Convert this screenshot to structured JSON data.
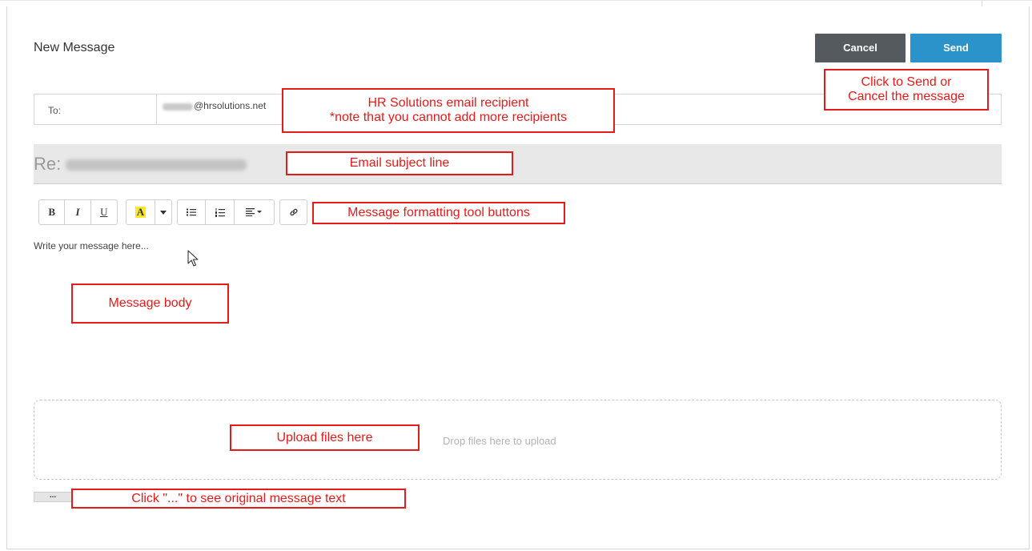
{
  "compose": {
    "title": "New Message",
    "cancel_label": "Cancel",
    "send_label": "Send",
    "to_label": "To:",
    "to_domain": "@hrsolutions.net",
    "subject_prefix": "Re:",
    "body_placeholder": "Write your message here...",
    "dropzone_text": "Drop files here to upload",
    "more_label": "..."
  },
  "toolbar": {
    "bold": "B",
    "italic": "I",
    "underline": "U",
    "highlight": "A",
    "highlight_color": "#f5e92a"
  },
  "annotations": {
    "send_cancel_line1": "Click to Send or",
    "send_cancel_line2": "Cancel the message",
    "recipient_line1": "HR Solutions email recipient",
    "recipient_line2": "*note that you cannot add more recipients",
    "subject": "Email subject line",
    "formatting": "Message formatting tool buttons",
    "body": "Message body",
    "upload": "Upload files here",
    "original": "Click \"...\" to see original message text"
  },
  "colors": {
    "send": "#2b93c9",
    "cancel": "#555a5e",
    "annotation": "#e51a1a"
  }
}
